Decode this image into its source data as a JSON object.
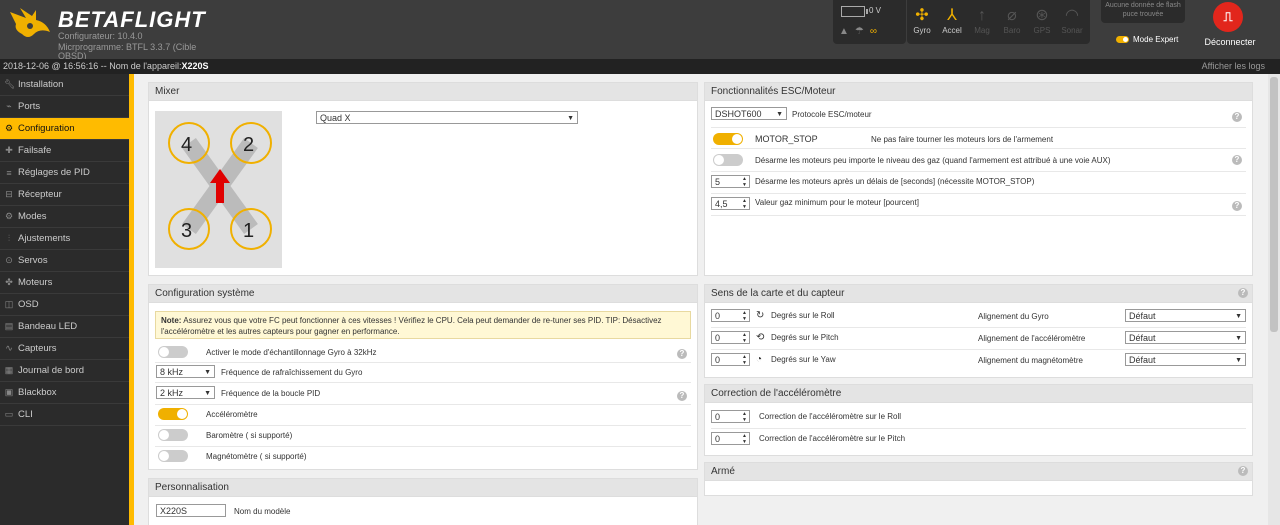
{
  "header": {
    "brand": "BETAFLIGHT",
    "configurator_version": "Configurateur: 10.4.0",
    "firmware_version": "Micrprogramme: BTFL 3.3.7 (Cible",
    "firmware_target": "OBSD)",
    "battery_voltage": "0 V",
    "sensors": [
      {
        "label": "Gyro",
        "icon": "gyro-icon",
        "active": true
      },
      {
        "label": "Accel",
        "icon": "accel-icon",
        "active": true
      },
      {
        "label": "Mag",
        "icon": "mag-icon",
        "active": false
      },
      {
        "label": "Baro",
        "icon": "baro-icon",
        "active": false
      },
      {
        "label": "GPS",
        "icon": "gps-icon",
        "active": false
      },
      {
        "label": "Sonar",
        "icon": "sonar-icon",
        "active": false
      }
    ],
    "flash_status": "Aucune donnée de flash puce trouvée",
    "expert_mode_label": "Mode Expert",
    "disconnect_label": "Déconnecter"
  },
  "statusbar": {
    "datetime_prefix": "2018-12-06 @ 16:56:16 -- Nom de l'appareil:",
    "device_name": "X220S",
    "show_logs": "Afficher les logs"
  },
  "sidebar": {
    "items": [
      {
        "label": "Installation",
        "icon": "wrench-icon"
      },
      {
        "label": "Ports",
        "icon": "plug-icon"
      },
      {
        "label": "Configuration",
        "icon": "gear-icon",
        "active": true
      },
      {
        "label": "Failsafe",
        "icon": "failsafe-icon"
      },
      {
        "label": "Réglages de PID",
        "icon": "sliders-icon"
      },
      {
        "label": "Récepteur",
        "icon": "receiver-icon"
      },
      {
        "label": "Modes",
        "icon": "modes-icon"
      },
      {
        "label": "Ajustements",
        "icon": "adjust-icon"
      },
      {
        "label": "Servos",
        "icon": "servo-icon"
      },
      {
        "label": "Moteurs",
        "icon": "motor-icon"
      },
      {
        "label": "OSD",
        "icon": "osd-icon"
      },
      {
        "label": "Bandeau LED",
        "icon": "led-icon"
      },
      {
        "label": "Capteurs",
        "icon": "sensor-icon"
      },
      {
        "label": "Journal de bord",
        "icon": "log-icon"
      },
      {
        "label": "Blackbox",
        "icon": "blackbox-icon"
      },
      {
        "label": "CLI",
        "icon": "cli-icon"
      }
    ]
  },
  "mixer": {
    "title": "Mixer",
    "selected": "Quad X",
    "motors": [
      "4",
      "2",
      "3",
      "1"
    ]
  },
  "esc": {
    "title": "Fonctionnalités ESC/Moteur",
    "protocol_value": "DSHOT600",
    "protocol_label": "Protocole ESC/moteur",
    "motor_stop_label": "MOTOR_STOP",
    "motor_stop_desc": "Ne pas faire tourner les moteurs lors de l'armement",
    "disarm_desc": "Désarme les moteurs peu importe le niveau des gaz (quand l'armement est attribué à une voie AUX)",
    "disarm_delay_value": "5",
    "disarm_delay_label": "Désarme les moteurs après un délais de [seconds] (nécessite MOTOR_STOP)",
    "min_throttle_value": "4,5",
    "min_throttle_label": "Valeur gaz minimum pour le moteur [pourcent]"
  },
  "system": {
    "title": "Configuration système",
    "note_bold": "Note:",
    "note_text": " Assurez vous que votre FC peut fonctionner à ces vitesses ! Vérifiez le CPU. Cela peut demander de re-tuner ses PID. TIP: Désactivez l'accéléromètre et les autres capteurs pour gagner en performance.",
    "gyro32_label": "Activer le mode d'échantillonnage Gyro à 32kHz",
    "gyro_rate_value": "8 kHz",
    "gyro_rate_label": "Fréquence de rafraîchissement du Gyro",
    "pid_rate_value": "2 kHz",
    "pid_rate_label": "Fréquence de la boucle PID",
    "accel_label": "Accéléromètre",
    "baro_label": "Baromètre ( si supporté)",
    "mag_label": "Magnétomètre ( si supporté)"
  },
  "board": {
    "title": "Sens de la carte et du capteur",
    "roll_value": "0",
    "roll_label": "Degrés sur le Roll",
    "pitch_value": "0",
    "pitch_label": "Degrés sur le Pitch",
    "yaw_value": "0",
    "yaw_label": "Degrés sur le Yaw",
    "gyro_align_label": "Alignement du Gyro",
    "acc_align_label": "Alignement de l'accéléromètre",
    "mag_align_label": "Alignement du magnétomètre",
    "align_value": "Défaut"
  },
  "accel_corr": {
    "title": "Correction de l'accéléromètre",
    "roll_value": "0",
    "roll_label": "Correction de l'accéléromètre sur le Roll",
    "pitch_value": "0",
    "pitch_label": "Correction de l'accéléromètre sur le Pitch"
  },
  "arme": {
    "title": "Armé"
  },
  "personal": {
    "title": "Personnalisation",
    "model_value": "X220S",
    "model_label": "Nom du modèle"
  }
}
